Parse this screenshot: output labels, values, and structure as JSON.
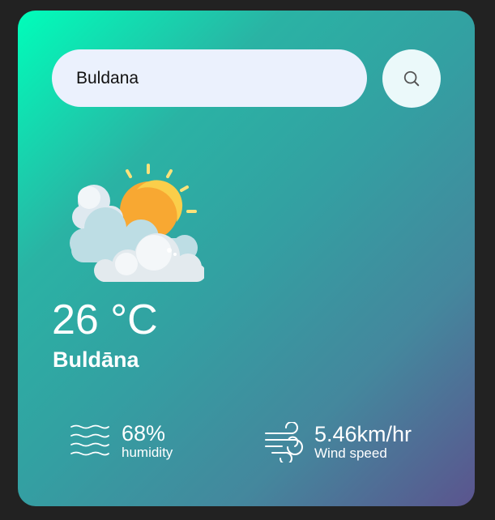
{
  "search": {
    "value": "Buldana",
    "button_icon": "search-icon"
  },
  "weather": {
    "icon": "partly-cloudy-sun-icon",
    "temperature": "26 °C",
    "city": "Buldāna"
  },
  "details": {
    "humidity": {
      "icon": "humidity-waves-icon",
      "value": "68%",
      "label": "humidity"
    },
    "wind": {
      "icon": "wind-icon",
      "value": "5.46km/hr",
      "label": "Wind speed"
    }
  },
  "colors": {
    "page_background": "#222222",
    "gradient_start": "#00feba",
    "gradient_end": "#5b548e",
    "search_field": "#ebf1fd",
    "text": "#ffffff"
  }
}
